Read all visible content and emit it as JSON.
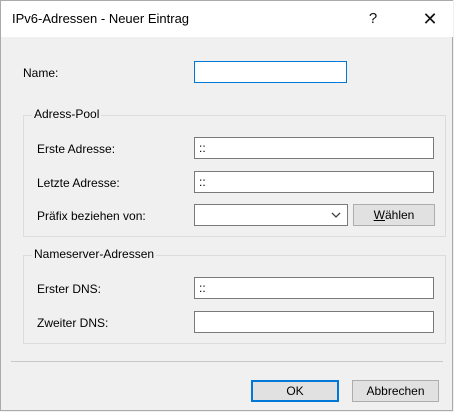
{
  "window": {
    "title": "IPv6-Adressen - Neuer Eintrag",
    "help_glyph": "?",
    "close_glyph": "✕"
  },
  "name": {
    "label": "Name:",
    "value": ""
  },
  "address_pool": {
    "title": "Adress-Pool",
    "first_label": "Erste Adresse:",
    "first_value": "::",
    "last_label": "Letzte Adresse:",
    "last_value": "::",
    "prefix_label": "Präfix beziehen von:",
    "prefix_value": "",
    "choose_button_prefix": "",
    "choose_button_mnemonic": "W",
    "choose_button_rest": "ählen"
  },
  "nameserver": {
    "title": "Nameserver-Adressen",
    "first_dns_label": "Erster DNS:",
    "first_dns_value": "::",
    "second_dns_label": "Zweiter DNS:",
    "second_dns_value": ""
  },
  "footer": {
    "ok_label": "OK",
    "cancel_label": "Abbrechen"
  },
  "colors": {
    "focus": "#0078d7",
    "background": "#f0f0f0"
  }
}
